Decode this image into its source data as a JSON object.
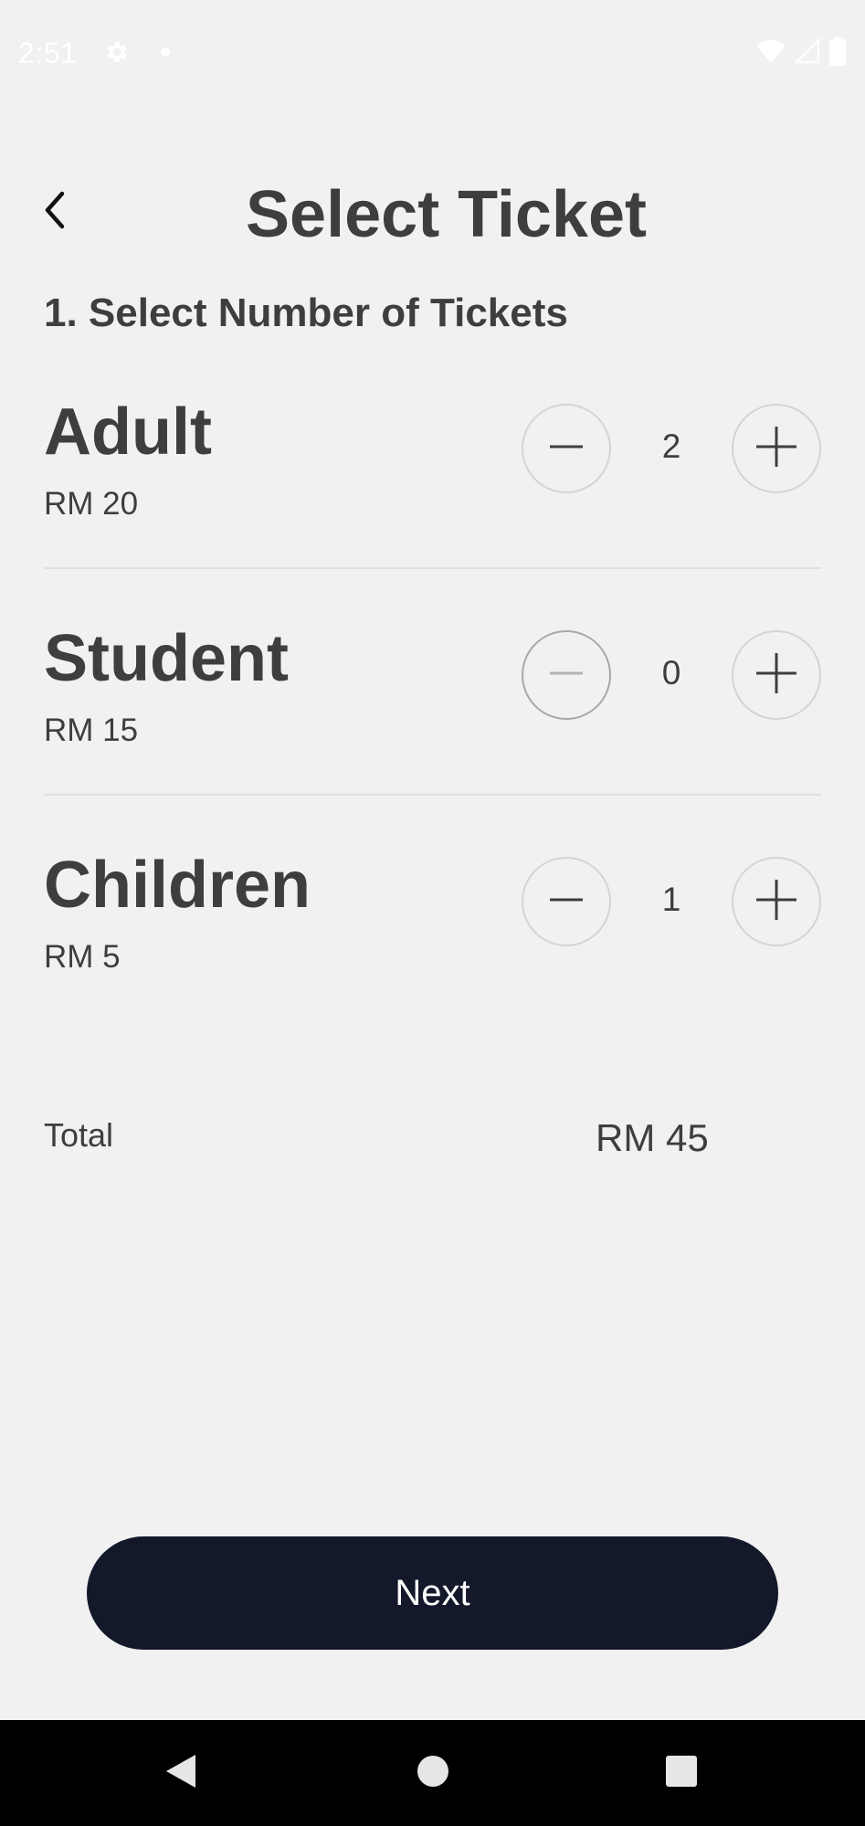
{
  "status_bar": {
    "time": "2:51",
    "icons": [
      "gear-icon",
      "notification-dot-icon",
      "wifi-icon",
      "cellular-signal-icon",
      "battery-icon"
    ]
  },
  "header": {
    "title": "Select Ticket",
    "back_icon": "chevron-left-icon"
  },
  "section": {
    "title": "1. Select Number of Tickets"
  },
  "tickets": [
    {
      "name": "Adult",
      "price": "RM 20",
      "count": "2",
      "minus_enabled": true
    },
    {
      "name": "Student",
      "price": "RM 15",
      "count": "0",
      "minus_enabled": false
    },
    {
      "name": "Children",
      "price": "RM 5",
      "count": "1",
      "minus_enabled": true
    }
  ],
  "total": {
    "label": "Total",
    "value": "RM 45"
  },
  "actions": {
    "next_label": "Next"
  },
  "nav": {
    "icons": [
      "back-triangle-icon",
      "home-circle-icon",
      "recents-square-icon"
    ]
  },
  "colors": {
    "background": "#f1f1f2",
    "text": "#3e3e40",
    "primary_button": "#13192a",
    "stepper_border": "#d4d4d6",
    "stepper_disabled": "#a8a8aa"
  }
}
